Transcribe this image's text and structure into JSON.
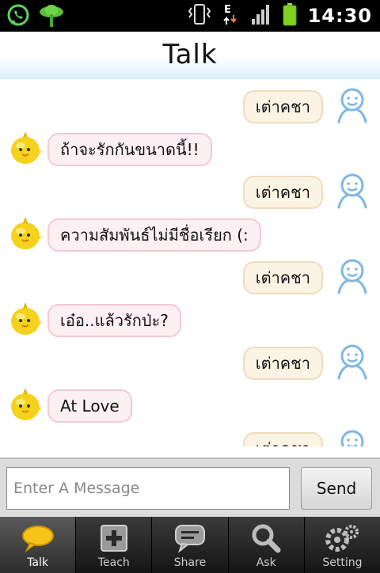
{
  "status_bar": {
    "time": "14:30",
    "network": "E",
    "icons": [
      "whatsapp-icon",
      "clover-icon",
      "vibrate-icon",
      "network-e-icon",
      "signal-icon",
      "battery-icon"
    ]
  },
  "header": {
    "title": "Talk"
  },
  "messages": [
    {
      "side": "right",
      "text": "เต่าคชา"
    },
    {
      "side": "left",
      "text": "ถ้าจะรักกันขนาดนี้!!"
    },
    {
      "side": "right",
      "text": "เต่าคชา"
    },
    {
      "side": "left",
      "text": "ความสัมพันธ์ไม่มีชื่อเรียก (:"
    },
    {
      "side": "right",
      "text": "เต่าคชา"
    },
    {
      "side": "left",
      "text": "เอ๋อ..แล้วรักป่ะ?"
    },
    {
      "side": "right",
      "text": "เต่าคชา"
    },
    {
      "side": "left",
      "text": "At Love"
    },
    {
      "side": "right",
      "text": "เต่าคชา"
    }
  ],
  "input": {
    "placeholder": "Enter A Message",
    "value": ""
  },
  "send_label": "Send",
  "nav": [
    {
      "label": "Talk",
      "icon": "chat-bubble-icon",
      "active": true
    },
    {
      "label": "Teach",
      "icon": "plus-box-icon",
      "active": false
    },
    {
      "label": "Share",
      "icon": "share-bubble-icon",
      "active": false
    },
    {
      "label": "Ask",
      "icon": "magnifier-icon",
      "active": false
    },
    {
      "label": "Setting",
      "icon": "gears-icon",
      "active": false
    }
  ],
  "colors": {
    "my_bubble": "#fbf3e3",
    "bot_bubble": "#fdf0f3",
    "header_tint": "#d9eef9"
  }
}
